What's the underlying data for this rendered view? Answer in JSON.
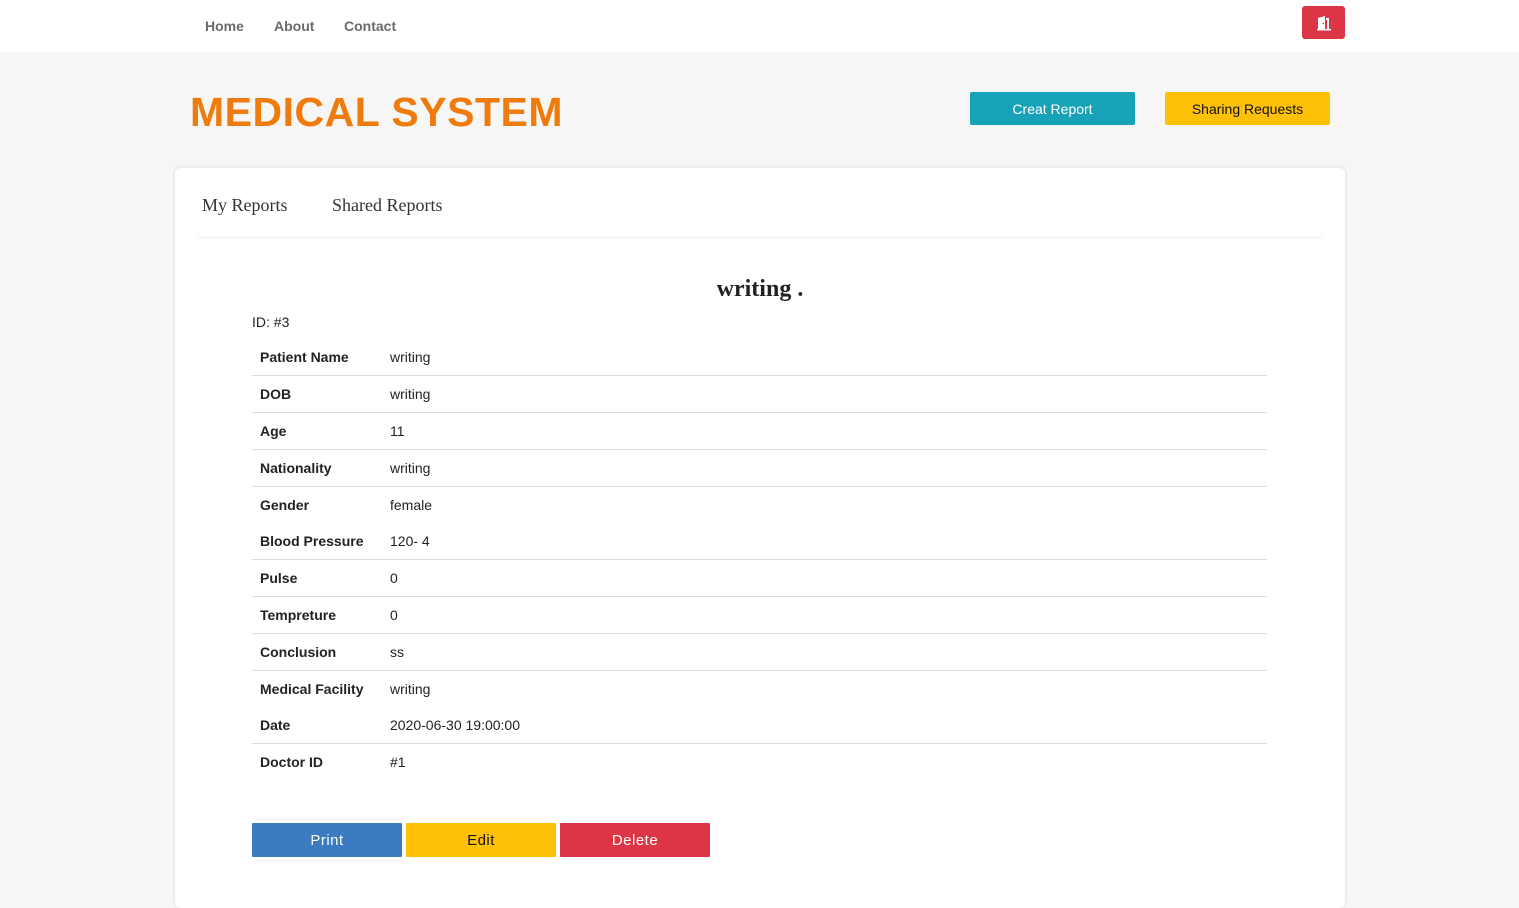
{
  "nav": {
    "home": "Home",
    "about": "About",
    "contact": "Contact",
    "logout_icon": "door-exit-icon"
  },
  "header": {
    "brand": "MEDICAL SYSTEM",
    "create_report": "Creat Report",
    "sharing_requests": "Sharing Requests"
  },
  "tabs": {
    "my_reports": "My Reports",
    "shared_reports": "Shared Reports"
  },
  "report": {
    "title": "writing .",
    "id": "ID: #3",
    "rows": [
      {
        "label": "Patient Name",
        "value": "writing"
      },
      {
        "label": "DOB",
        "value": "writing"
      },
      {
        "label": "Age",
        "value": "11"
      },
      {
        "label": "Nationality",
        "value": "writing"
      },
      {
        "label": "Gender",
        "value": "female"
      },
      {
        "label": "Blood Pressure",
        "value": "120- 4"
      },
      {
        "label": "Pulse",
        "value": "0"
      },
      {
        "label": "Tempreture",
        "value": "0"
      },
      {
        "label": "Conclusion",
        "value": "ss"
      },
      {
        "label": "Medical Facility",
        "value": "writing"
      },
      {
        "label": "Date",
        "value": "2020-06-30 19:00:00"
      },
      {
        "label": "Doctor ID",
        "value": "#1"
      }
    ]
  },
  "actions": {
    "print": "Print",
    "edit": "Edit",
    "delete": "Delete"
  },
  "colors": {
    "brand": "#f07b0d",
    "info": "#17a2b8",
    "warning": "#ffc107",
    "danger": "#dc3545",
    "primary": "#3a7bc1"
  }
}
